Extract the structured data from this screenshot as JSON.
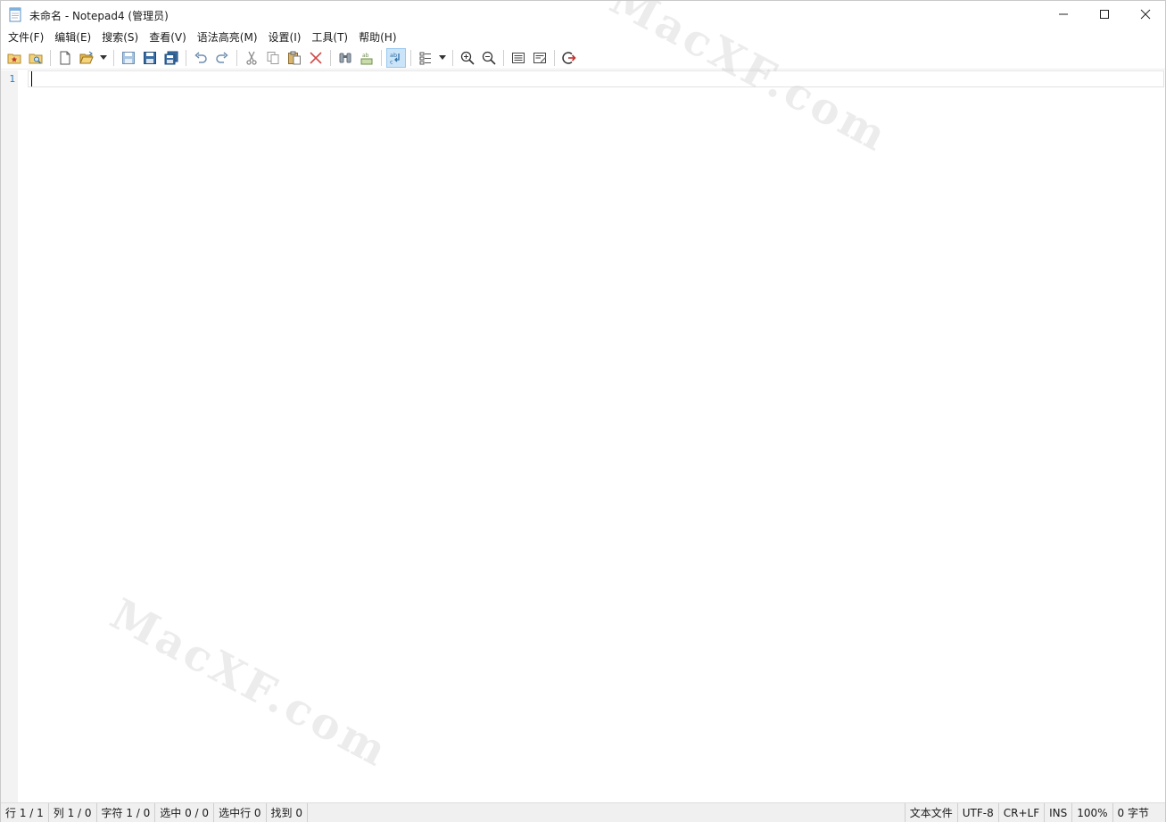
{
  "window": {
    "title": "未命名 - Notepad4 (管理员)",
    "app_icon": "notepad-icon"
  },
  "menu": [
    "文件(F)",
    "编辑(E)",
    "搜索(S)",
    "查看(V)",
    "语法高亮(M)",
    "设置(I)",
    "工具(T)",
    "帮助(H)"
  ],
  "toolbar": {
    "icons": [
      "favorites-icon",
      "browse-icon",
      "new-file-icon",
      "open-file-icon",
      "open-dropdown-icon",
      "save-icon",
      "save-as-icon",
      "save-copy-icon",
      "undo-icon",
      "redo-icon",
      "cut-icon",
      "copy-icon",
      "paste-icon",
      "delete-icon",
      "find-icon",
      "replace-icon",
      "word-wrap-icon",
      "scheme-icon",
      "scheme-dropdown-icon",
      "zoom-in-icon",
      "zoom-out-icon",
      "document-properties-icon",
      "edit-settings-icon",
      "exit-icon"
    ]
  },
  "editor": {
    "line_number": "1",
    "content": ""
  },
  "watermark": "MacXF.com",
  "status": {
    "line": "行 1 / 1",
    "column": "列 1 / 0",
    "char": "字符 1 / 0",
    "selection": "选中 0 / 0",
    "selected_lines": "选中行 0",
    "found": "找到 0",
    "file_type": "文本文件",
    "encoding": "UTF-8",
    "line_ending": "CR+LF",
    "insert_mode": "INS",
    "zoom": "100%",
    "size": "0 字节"
  },
  "colors": {
    "active_button_bg": "#cce4f7",
    "line_number": "#2b7bbf",
    "gutter_bg": "#f3f3f3",
    "statusbar_bg": "#f0f0f0"
  }
}
